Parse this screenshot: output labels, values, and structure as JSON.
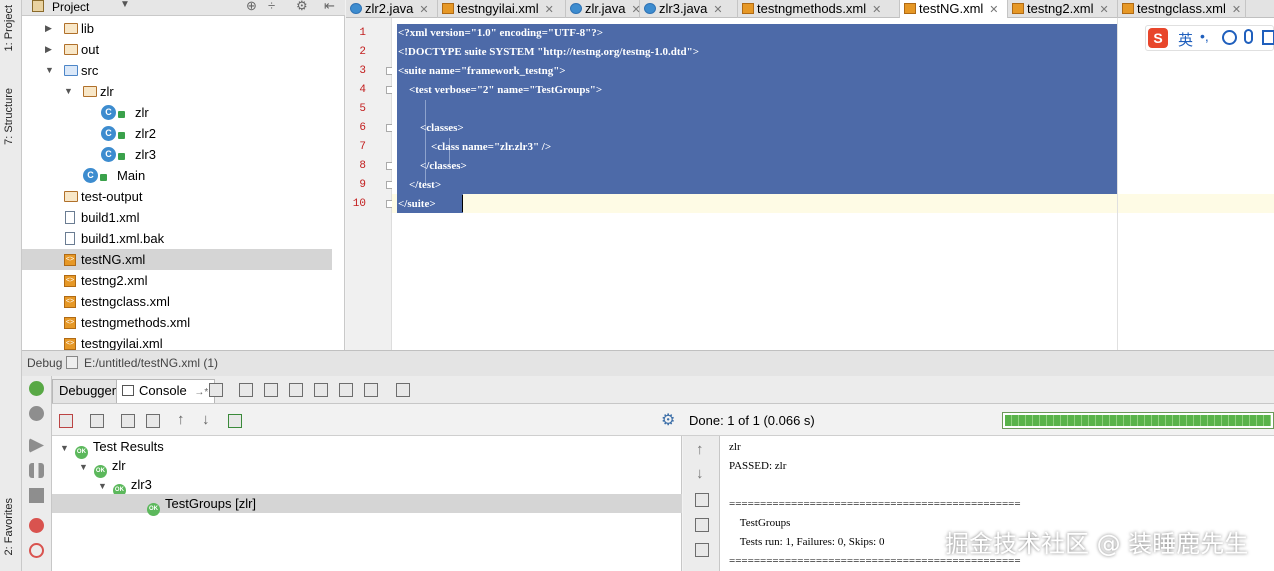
{
  "left_rail": {
    "project": "1: Project",
    "structure": "7: Structure",
    "favorites": "2: Favorites"
  },
  "project_panel": {
    "title": "Project",
    "tree": [
      {
        "label": "lib",
        "icon": "folder-icon",
        "depth": 1,
        "expand": "collapsed"
      },
      {
        "label": "out",
        "icon": "folder-icon",
        "depth": 1,
        "expand": "collapsed"
      },
      {
        "label": "src",
        "icon": "source-folder-icon",
        "depth": 1,
        "expand": "expanded"
      },
      {
        "label": "zlr",
        "icon": "package-icon",
        "depth": 2,
        "expand": "expanded"
      },
      {
        "label": "zlr",
        "icon": "java-class-icon",
        "depth": 3
      },
      {
        "label": "zlr2",
        "icon": "java-class-icon",
        "depth": 3
      },
      {
        "label": "zlr3",
        "icon": "java-class-icon",
        "depth": 3
      },
      {
        "label": "Main",
        "icon": "java-class-icon",
        "depth": 2
      },
      {
        "label": "test-output",
        "icon": "folder-icon",
        "depth": 1
      },
      {
        "label": "build1.xml",
        "icon": "file-icon",
        "depth": 1
      },
      {
        "label": "build1.xml.bak",
        "icon": "file-icon",
        "depth": 1
      },
      {
        "label": "testNG.xml",
        "icon": "xml-file-icon",
        "depth": 1,
        "selected": true
      },
      {
        "label": "testng2.xml",
        "icon": "xml-file-icon",
        "depth": 1
      },
      {
        "label": "testngclass.xml",
        "icon": "xml-file-icon",
        "depth": 1
      },
      {
        "label": "testngmethods.xml",
        "icon": "xml-file-icon",
        "depth": 1
      },
      {
        "label": "testngyilai.xml",
        "icon": "xml-file-icon",
        "depth": 1
      }
    ]
  },
  "editor_tabs": [
    {
      "label": "zlr2.java",
      "icon": "java"
    },
    {
      "label": "testngyilai.xml",
      "icon": "xml"
    },
    {
      "label": "zlr.java",
      "icon": "java"
    },
    {
      "label": "zlr3.java",
      "icon": "java"
    },
    {
      "label": "testngmethods.xml",
      "icon": "xml"
    },
    {
      "label": "testNG.xml",
      "icon": "xml",
      "active": true
    },
    {
      "label": "testng2.xml",
      "icon": "xml"
    },
    {
      "label": "testngclass.xml",
      "icon": "xml"
    }
  ],
  "editor": {
    "line_numbers": [
      "1",
      "2",
      "3",
      "4",
      "5",
      "6",
      "7",
      "8",
      "9",
      "10"
    ],
    "lines": [
      "<?xml version=\"1.0\" encoding=\"UTF-8\"?>",
      "<!DOCTYPE suite SYSTEM \"http://testng.org/testng-1.0.dtd\">",
      "<suite name=\"framework_testng\">",
      "    <test verbose=\"2\" name=\"TestGroups\">",
      "",
      "        <classes>",
      "            <class name=\"zlr.zlr3\" />",
      "        </classes>",
      "    </test>",
      "</suite>"
    ]
  },
  "ime": {
    "mode": "英"
  },
  "debug": {
    "label": "Debug",
    "path": "E:/untitled/testNG.xml (1)",
    "tabs": [
      "Debugger",
      "Console"
    ],
    "status": "Done: 1 of 1 (0.066 s)",
    "progress_fraction": 1.0,
    "results": [
      {
        "label": "Test Results",
        "depth": 0
      },
      {
        "label": "zlr",
        "depth": 1
      },
      {
        "label": "zlr3",
        "depth": 2
      },
      {
        "label": "TestGroups [zlr]",
        "depth": 3,
        "selected": true
      }
    ],
    "console_lines": [
      "zlr",
      "PASSED: zlr",
      "",
      "===============================================",
      "    TestGroups",
      "    Tests run: 1, Failures: 0, Skips: 0",
      "==============================================="
    ]
  },
  "watermark": "掘金技术社区 @ 装睡鹿先生"
}
